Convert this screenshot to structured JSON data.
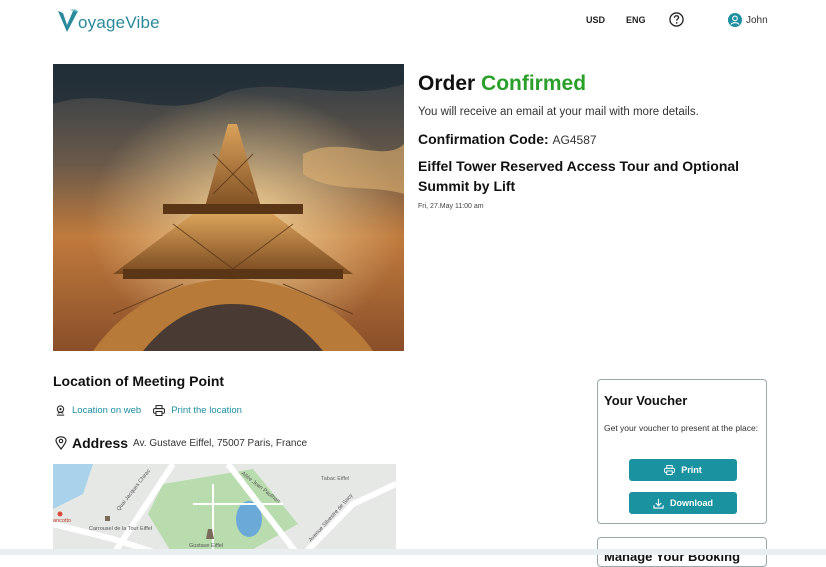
{
  "header": {
    "logo_text": "oyageVibe",
    "currency": "USD",
    "language": "ENG",
    "user_name": "John"
  },
  "order": {
    "title_prefix": "Order",
    "title_status": "Confirmed",
    "subtitle": "You will receive an email at your mail with more details.",
    "confirmation_label": "Confirmation Code:",
    "confirmation_code": "AG4587",
    "tour_name": "Eiffel Tower Reserved Access Tour and Optional Summit by Lift",
    "date": "Fri, 27.May 11:00 am"
  },
  "location": {
    "title": "Location of Meeting Point",
    "link_web": "Location on web",
    "link_print": "Print the location",
    "address_label": "Address",
    "address_value": "Av. Gustave Eiffel, 75007 Paris, France",
    "map_labels": {
      "road1": "Quai Jacques Chirac",
      "road2": "Allée Jean Paulhan",
      "road3": "Avenue Silvestre de Sacy",
      "place1": "Tabac Eiffel",
      "place2": "Carrousel de la Tour Eiffel",
      "place3": "Gustave Eiffel",
      "place4": "ancotto"
    }
  },
  "voucher": {
    "title": "Your Voucher",
    "description": "Get your voucher to present at the place:",
    "print_label": "Print",
    "download_label": "Download"
  },
  "manage": {
    "title": "Manage Your Booking"
  },
  "colors": {
    "brand": "#2a8a9a",
    "accent_button": "#1a92a0",
    "confirmed_green": "#2aa02a",
    "link": "#1f8fa0"
  }
}
